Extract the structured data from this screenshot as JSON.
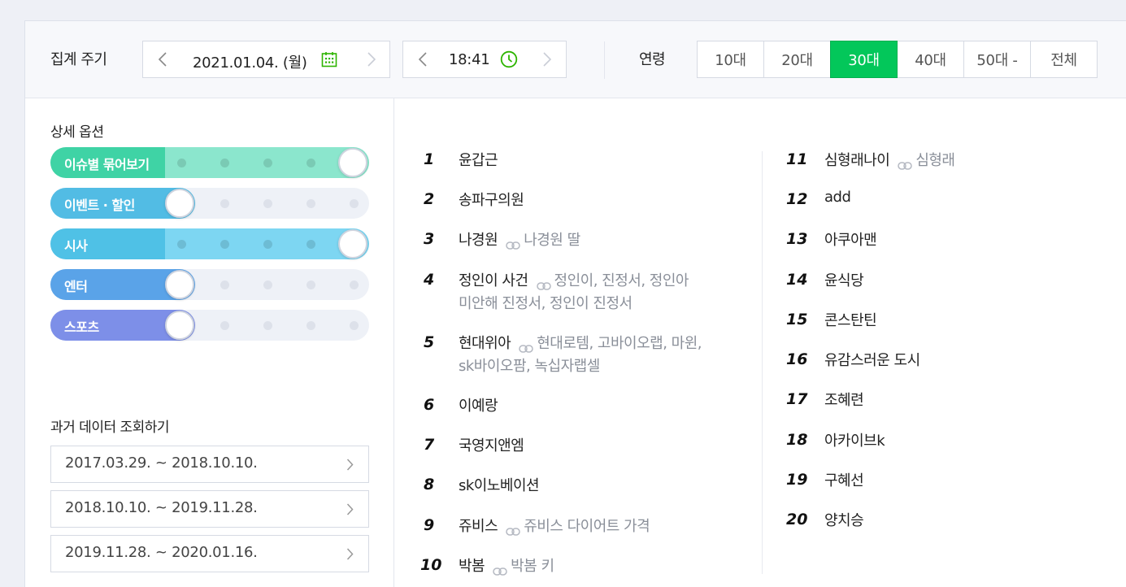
{
  "header": {
    "period_label": "집계 주기",
    "date_value": "2021.01.04. (월)",
    "time_value": "18:41",
    "age_label": "연령",
    "age_options": [
      "10대",
      "20대",
      "30대",
      "40대",
      "50대 -",
      "전체"
    ],
    "age_selected": "30대"
  },
  "options": {
    "title": "상세 옵션",
    "toggles": [
      {
        "label": "이슈별 묶어보기",
        "on": true,
        "color_from": "#3fd3a5",
        "color_to": "#8be6cd"
      },
      {
        "label": "이벤트 · 할인",
        "on": false,
        "color_from": "#52bce4",
        "color_to": "#6ec8ea"
      },
      {
        "label": "시사",
        "on": true,
        "color_from": "#4fc1e6",
        "color_to": "#7dd6f2"
      },
      {
        "label": "엔터",
        "on": false,
        "color_from": "#5aa3e8",
        "color_to": "#6cb0ec"
      },
      {
        "label": "스포츠",
        "on": false,
        "color_from": "#7d8fe8",
        "color_to": "#8c9bee"
      }
    ]
  },
  "history": {
    "title": "과거 데이터 조회하기",
    "ranges": [
      "2017.03.29. ~ 2018.10.10.",
      "2018.10.10. ~ 2019.11.28.",
      "2019.11.28. ~ 2020.01.16."
    ]
  },
  "rankings": [
    {
      "rank": "1",
      "keyword": "윤갑근",
      "related": "",
      "related2": ""
    },
    {
      "rank": "2",
      "keyword": "송파구의원",
      "related": "",
      "related2": ""
    },
    {
      "rank": "3",
      "keyword": "나경원",
      "related": "나경원 딸",
      "related2": ""
    },
    {
      "rank": "4",
      "keyword": "정인이 사건",
      "related": "정인이, 진정서, 정인아",
      "related2": "미안해 진정서, 정인이 진정서"
    },
    {
      "rank": "5",
      "keyword": "현대위아",
      "related": "현대로템, 고바이오랩, 마윈,",
      "related2": "sk바이오팜, 녹십자랩셀"
    },
    {
      "rank": "6",
      "keyword": "이예랑",
      "related": "",
      "related2": ""
    },
    {
      "rank": "7",
      "keyword": "국영지앤엠",
      "related": "",
      "related2": ""
    },
    {
      "rank": "8",
      "keyword": "sk이노베이션",
      "related": "",
      "related2": ""
    },
    {
      "rank": "9",
      "keyword": "쥬비스",
      "related": "쥬비스 다이어트 가격",
      "related2": ""
    },
    {
      "rank": "10",
      "keyword": "박봄",
      "related": "박봄 키",
      "related2": ""
    },
    {
      "rank": "11",
      "keyword": "심형래나이",
      "related": "심형래",
      "related2": ""
    },
    {
      "rank": "12",
      "keyword": "add",
      "related": "",
      "related2": ""
    },
    {
      "rank": "13",
      "keyword": "아쿠아맨",
      "related": "",
      "related2": ""
    },
    {
      "rank": "14",
      "keyword": "윤식당",
      "related": "",
      "related2": ""
    },
    {
      "rank": "15",
      "keyword": "콘스탄틴",
      "related": "",
      "related2": ""
    },
    {
      "rank": "16",
      "keyword": "유감스러운 도시",
      "related": "",
      "related2": ""
    },
    {
      "rank": "17",
      "keyword": "조혜련",
      "related": "",
      "related2": ""
    },
    {
      "rank": "18",
      "keyword": "아카이브k",
      "related": "",
      "related2": ""
    },
    {
      "rank": "19",
      "keyword": "구혜선",
      "related": "",
      "related2": ""
    },
    {
      "rank": "20",
      "keyword": "양치승",
      "related": "",
      "related2": ""
    }
  ],
  "colors": {
    "accent": "#03c75a",
    "calendar_icon": "#2db400",
    "clock_icon": "#2db400"
  },
  "icons": [
    "chevron-left-icon",
    "chevron-right-icon",
    "calendar-icon",
    "clock-icon",
    "link-icon"
  ]
}
